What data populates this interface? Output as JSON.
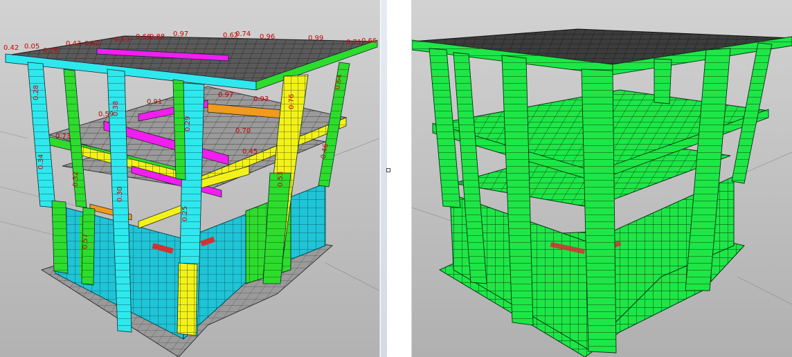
{
  "views": [
    {
      "name": "utilization-ratio-view",
      "render": "color-coded"
    },
    {
      "name": "model-view",
      "render": "uniform"
    }
  ],
  "colors": {
    "background_top": "#d2d2d2",
    "background_bottom": "#b4b4b4",
    "ground_mesh": "#6e6e6e",
    "slab_top": "#3c3c3c",
    "slab_grey": "#9a9a9a",
    "column_cyan": "#2ee8ee",
    "column_green": "#2ddc2d",
    "beam_yellow": "#f2f21a",
    "beam_magenta": "#f01ef0",
    "beam_orange": "#f09a1e",
    "wall_cyan": "#1fc4d6",
    "model_green": "#1ee646",
    "label_red": "#c80000",
    "load_red": "#d23232"
  },
  "left_labels": [
    {
      "text": "0.42"
    },
    {
      "text": "0.05"
    },
    {
      "text": "0.26"
    },
    {
      "text": "0.43"
    },
    {
      "text": "0.62"
    },
    {
      "text": "0.13"
    },
    {
      "text": "0.66"
    },
    {
      "text": "0.88"
    },
    {
      "text": "0.97"
    },
    {
      "text": "0.62"
    },
    {
      "text": "0.74"
    },
    {
      "text": "0.96"
    },
    {
      "text": "0.99"
    },
    {
      "text": "0.71"
    },
    {
      "text": "0.66"
    },
    {
      "text": "0.28"
    },
    {
      "text": "0.38"
    },
    {
      "text": "0.29"
    },
    {
      "text": "0.76"
    },
    {
      "text": "0.64"
    },
    {
      "text": "0.91"
    },
    {
      "text": "0.97"
    },
    {
      "text": "0.93"
    },
    {
      "text": "0.59"
    },
    {
      "text": "0.73"
    },
    {
      "text": "0.70"
    },
    {
      "text": "0.45"
    },
    {
      "text": "0.32"
    },
    {
      "text": "0.30"
    },
    {
      "text": "0.25"
    },
    {
      "text": "0.53"
    },
    {
      "text": "0.46"
    },
    {
      "text": "0.57"
    },
    {
      "text": "0.34"
    }
  ]
}
